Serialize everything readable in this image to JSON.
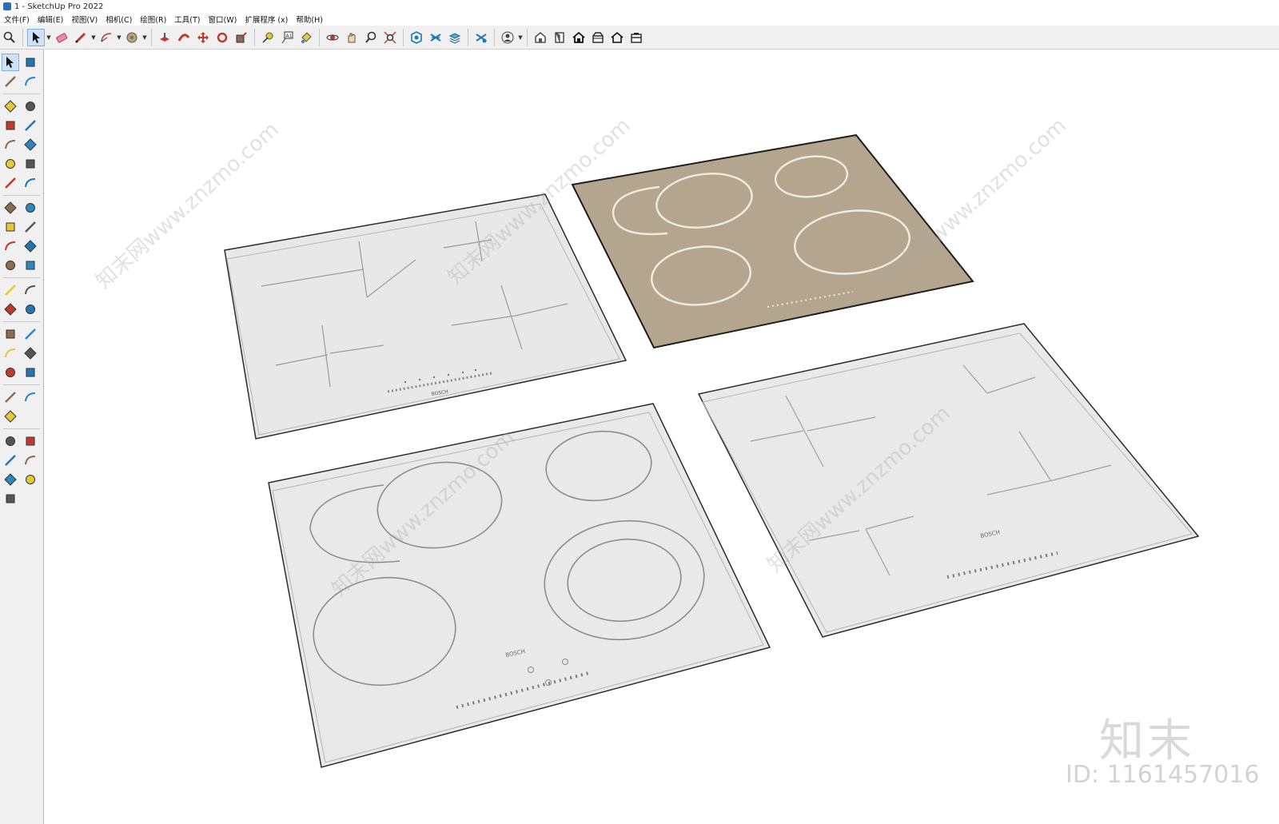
{
  "window": {
    "title": "1 - SketchUp Pro 2022"
  },
  "menu": [
    "文件(F)",
    "编辑(E)",
    "视图(V)",
    "相机(C)",
    "绘图(R)",
    "工具(T)",
    "窗口(W)",
    "扩展程序 (x)",
    "帮助(H)"
  ],
  "toolbar_icons": [
    "zoom-icon",
    "select-icon",
    "eraser-icon",
    "pencil-icon",
    "arc-icon",
    "circle-icon",
    "pushpull-icon",
    "followme-icon",
    "move-icon",
    "rotate-icon",
    "scale-icon",
    "tape-icon",
    "text-icon",
    "paint-icon",
    "orbit-icon",
    "pan-icon",
    "zoom2-icon",
    "zoom-extents-icon",
    "component-icon",
    "section-icon",
    "layers-icon",
    "styles-icon",
    "account-icon",
    "warehouse-icon",
    "ext-warehouse-icon",
    "home-icon",
    "share-icon",
    "house-icon",
    "store-icon"
  ],
  "left_icons": [
    "select-icon",
    "orbit-icon",
    "paint-icon",
    "eraser-icon",
    "component-icon",
    "tag-icon",
    "pencil-icon",
    "freehand-icon",
    "rectangle-icon",
    "rotated-rect-icon",
    "circle-icon",
    "polygon-icon",
    "arc-icon",
    "arc2-icon",
    "arc3-icon",
    "pie-icon",
    "move-icon",
    "pushpull-icon",
    "rotate-icon",
    "followme-icon",
    "scale-icon",
    "offset-icon",
    "tape-icon",
    "dimension-icon",
    "protractor-icon",
    "text-icon",
    "axes-icon",
    "3dtext-icon",
    "orbit2-icon",
    "pan-icon",
    "zoom-icon",
    "zoom-window-icon",
    "zoom-extents-icon",
    "previous-icon",
    "position-camera-icon",
    "lookaround-icon",
    "walk-icon",
    "section-icon",
    "warehouse-icon",
    "share-icon",
    "ext-icon",
    "ext2-icon"
  ],
  "scene": {
    "brand_label": "BOSCH",
    "colors": {
      "white_cooktop": "#e9e9e9",
      "beige_cooktop": "#b3a48f",
      "ring_on_beige": "#eeeae0",
      "edge": "#2b2b2b"
    }
  },
  "watermark": {
    "brand": "知末",
    "id_text": "ID: 1161457016",
    "diagonal_text": "知末网www.znzmo.com"
  }
}
